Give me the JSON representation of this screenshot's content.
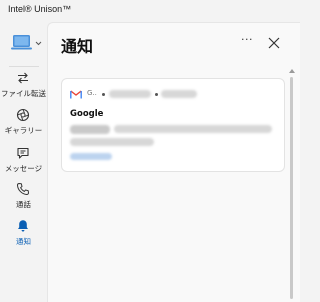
{
  "window": {
    "title": "Intel® Unison™"
  },
  "sidebar": {
    "items": [
      {
        "label": "ファイル転送",
        "icon": "transfer-icon"
      },
      {
        "label": "ギャラリー",
        "icon": "gallery-icon"
      },
      {
        "label": "メッセージ",
        "icon": "message-icon"
      },
      {
        "label": "通話",
        "icon": "phone-icon"
      },
      {
        "label": "通知",
        "icon": "bell-icon",
        "active": true
      }
    ]
  },
  "main": {
    "title": "通知",
    "more_label": "···"
  },
  "notification": {
    "app": "G..",
    "sender": "Google"
  },
  "colors": {
    "accent": "#0a5fb4",
    "gmail_red": "#ea4335"
  }
}
